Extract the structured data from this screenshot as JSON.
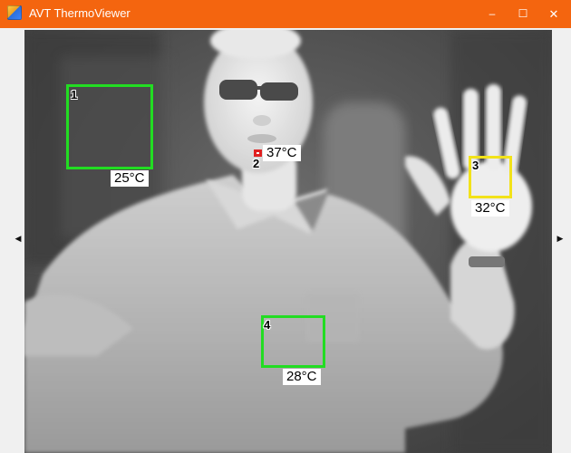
{
  "window": {
    "title": "AVT ThermoViewer",
    "icon": "thermo-app-icon",
    "controls": {
      "minimize": "–",
      "maximize": "☐",
      "close": "✕"
    }
  },
  "nav": {
    "left_arrow": "◀",
    "right_arrow": "▶"
  },
  "image": {
    "description_palette": "grayscale thermal",
    "rois": [
      {
        "id": "1",
        "temperature": "25°C",
        "color": "#22dd22",
        "shape": "rectangle"
      },
      {
        "id": "2",
        "temperature": "37°C",
        "color": "#e02020",
        "shape": "spot"
      },
      {
        "id": "3",
        "temperature": "32°C",
        "color": "#f2e21a",
        "shape": "rectangle"
      },
      {
        "id": "4",
        "temperature": "28°C",
        "color": "#22dd22",
        "shape": "rectangle"
      }
    ]
  }
}
